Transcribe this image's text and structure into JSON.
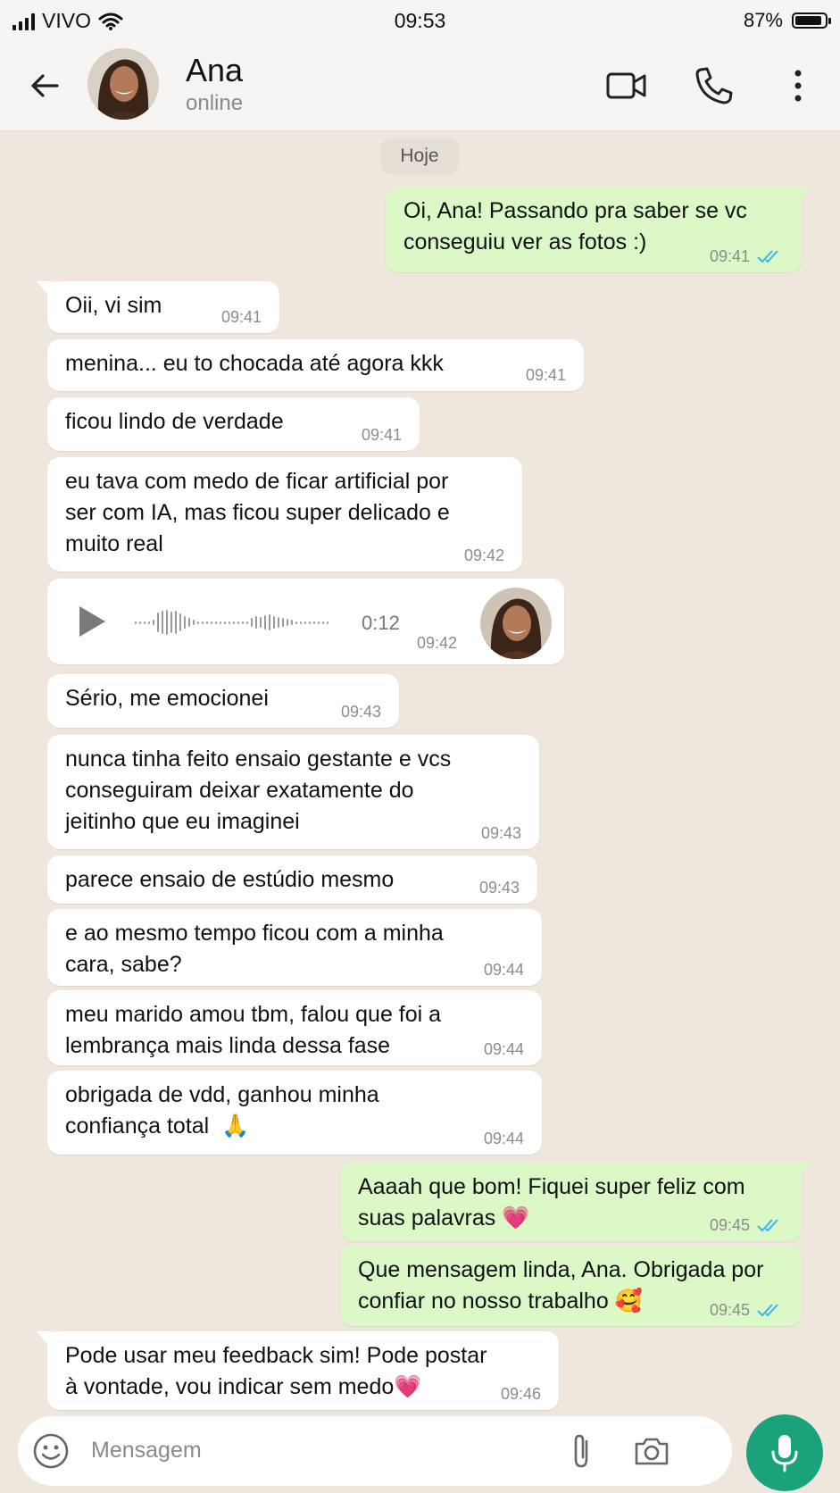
{
  "status_bar": {
    "carrier": "VIVO",
    "time": "09:53",
    "battery": "87%"
  },
  "header": {
    "name": "Ana",
    "status": "online"
  },
  "date_chip": "Hoje",
  "messages": [
    {
      "dir": "out",
      "text": "Oi, Ana! Passando pra saber se vc\nconseguiu ver as fotos :)",
      "time": "09:41"
    },
    {
      "dir": "in",
      "text": "Oii, vi sim",
      "time": "09:41"
    },
    {
      "dir": "in",
      "text": "menina... eu to chocada até agora kkk",
      "time": "09:41"
    },
    {
      "dir": "in",
      "text": "ficou lindo de verdade",
      "time": "09:41"
    },
    {
      "dir": "in",
      "text": "eu tava com medo de ficar artificial por\nser com IA, mas ficou super delicado e\nmuito real",
      "time": "09:42"
    },
    {
      "dir": "in",
      "type": "voice",
      "duration": "0:12",
      "time": "09:42"
    },
    {
      "dir": "in",
      "text": "Sério, me emocionei",
      "time": "09:43"
    },
    {
      "dir": "in",
      "text": "nunca tinha feito ensaio gestante e vcs\nconseguiram deixar exatamente do\njeitinho que eu imaginei",
      "time": "09:43"
    },
    {
      "dir": "in",
      "text": "parece ensaio de estúdio mesmo",
      "time": "09:43"
    },
    {
      "dir": "in",
      "text": "e ao mesmo tempo ficou com a minha\ncara, sabe?",
      "time": "09:44"
    },
    {
      "dir": "in",
      "text": "meu marido amou tbm, falou que foi a\nlembrança mais linda dessa fase",
      "time": "09:44"
    },
    {
      "dir": "in",
      "text": "obrigada de vdd, ganhou minha\nconfiança total  🙏",
      "time": "09:44"
    },
    {
      "dir": "out",
      "text": "Aaaah que bom! Fiquei super feliz com\nsuas palavras 💗",
      "time": "09:45"
    },
    {
      "dir": "out",
      "text": "Que mensagem linda, Ana. Obrigada por\nconfiar no nosso trabalho 🥰",
      "time": "09:45"
    },
    {
      "dir": "in",
      "text": "Pode usar meu feedback sim! Pode postar\nà vontade, vou indicar sem medo💗",
      "time": "09:46"
    }
  ],
  "input": {
    "placeholder": "Mensagem"
  },
  "colors": {
    "outgoing": "#dcf8c6",
    "incoming": "#ffffff",
    "accent": "#1aa37a",
    "tick": "#34b7f1",
    "background": "#efe7dd"
  }
}
